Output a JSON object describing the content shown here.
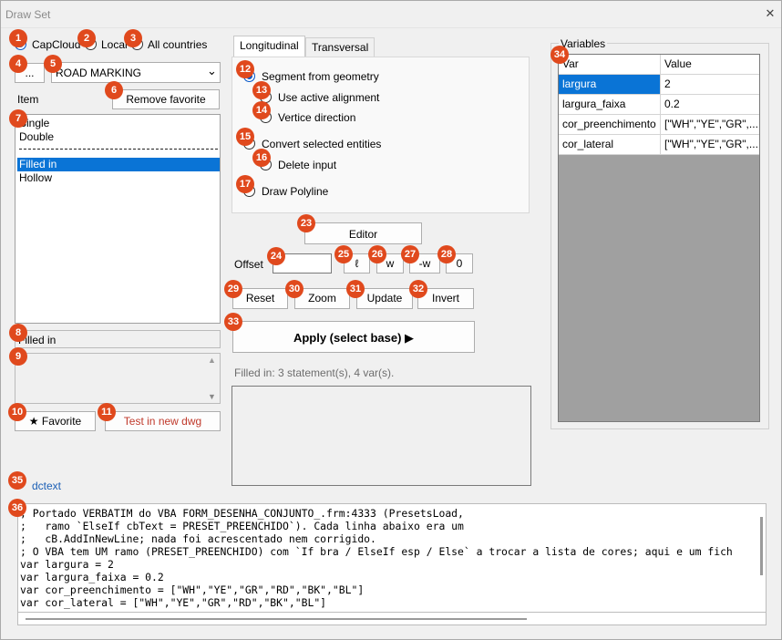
{
  "window": {
    "title": "Draw Set",
    "close_glyph": "✕"
  },
  "source": {
    "options": [
      "CapCloud",
      "Local",
      "All countries"
    ],
    "selected": "CapCloud"
  },
  "browse_button": "...",
  "category_select": {
    "value": "ROAD MARKING",
    "arrow": "⌄"
  },
  "item_label": "Item",
  "remove_favorite_button": "Remove favorite",
  "item_list": {
    "items": [
      "Single",
      "Double",
      "Filled in",
      "Hollow"
    ],
    "selected": "Filled in",
    "separator": "--------------------------------------"
  },
  "selected_name": "Filled in",
  "favorite_button": "★ Favorite",
  "test_button": "Test in new dwg",
  "tabs": [
    "Longitudinal",
    "Transversal"
  ],
  "active_tab": "Longitudinal",
  "options_panel": {
    "segment_from_geometry": "Segment from geometry",
    "use_active_alignment": "Use active alignment",
    "vertice_direction": "Vertice direction",
    "convert_selected_entities": "Convert selected entities",
    "delete_input": "Delete input",
    "draw_polyline": "Draw Polyline"
  },
  "editor_button": "Editor",
  "offset": {
    "label": "Offset",
    "value": "",
    "buttons": [
      "ℓ",
      "w",
      "-w",
      "0"
    ]
  },
  "actions": {
    "reset": "Reset",
    "zoom": "Zoom",
    "update": "Update",
    "invert": "Invert"
  },
  "apply_button": "Apply (select base) ▶",
  "status_text": "Filled in: 3 statement(s), 4 var(s).",
  "variables": {
    "group_label": "Variables",
    "columns": [
      "Var",
      "Value"
    ],
    "rows": [
      {
        "var": "largura",
        "value": "2"
      },
      {
        "var": "largura_faixa",
        "value": "0.2"
      },
      {
        "var": "cor_preenchimento",
        "value": "[\"WH\",\"YE\",\"GR\",..."
      },
      {
        "var": "cor_lateral",
        "value": "[\"WH\",\"YE\",\"GR\",..."
      }
    ],
    "selected_var": "largura"
  },
  "dctext_label": "dctext",
  "code_lines": [
    "; Portado VERBATIM do VBA FORM_DESENHA_CONJUNTO_.frm:4333 (PresetsLoad,",
    ";   ramo `ElseIf cbText = PRESET_PREENCHIDO`). Cada linha abaixo era um",
    ";   cB.AddInNewLine; nada foi acrescentado nem corrigido.",
    "; O VBA tem UM ramo (PRESET_PREENCHIDO) com `If bra / ElseIf esp / Else` a trocar a lista de cores; aqui e um fich",
    "var largura = 2",
    "var largura_faixa = 0.2",
    "var cor_preenchimento = [\"WH\",\"YE\",\"GR\",\"RD\",\"BK\",\"BL\"]",
    "var cor_lateral = [\"WH\",\"YE\",\"GR\",\"RD\",\"BK\",\"BL\"]",
    "; ..."
  ],
  "badges": [
    "1",
    "2",
    "3",
    "4",
    "5",
    "6",
    "7",
    "8",
    "9",
    "10",
    "11",
    "12",
    "13",
    "14",
    "15",
    "16",
    "17",
    "23",
    "24",
    "25",
    "26",
    "27",
    "28",
    "29",
    "30",
    "31",
    "32",
    "33",
    "34",
    "35",
    "36"
  ],
  "colors": {
    "accent": "#0a74d6",
    "badge": "#e0491d",
    "test_button_text": "#c0392b",
    "link": "#1b5fb5"
  }
}
